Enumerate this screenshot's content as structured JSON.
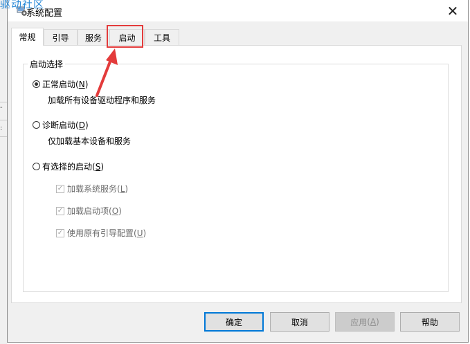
{
  "watermark": "驱动社区",
  "window": {
    "title": "系统配置",
    "close_glyph": "✕"
  },
  "tabs": [
    {
      "label": "常规",
      "active": true
    },
    {
      "label": "引导",
      "active": false
    },
    {
      "label": "服务",
      "active": false
    },
    {
      "label": "启动",
      "active": false
    },
    {
      "label": "工具",
      "active": false
    }
  ],
  "startup_group": {
    "title": "启动选择",
    "options": [
      {
        "label": "正常启动",
        "key": "N",
        "desc": "加载所有设备驱动程序和服务",
        "checked": true
      },
      {
        "label": "诊断启动",
        "key": "D",
        "desc": "仅加载基本设备和服务",
        "checked": false
      },
      {
        "label": "有选择的启动",
        "key": "S",
        "checked": false
      }
    ],
    "sub_options": [
      {
        "label": "加载系统服务",
        "key": "L",
        "checked": true,
        "disabled": true
      },
      {
        "label": "加载启动项",
        "key": "O",
        "checked": true,
        "disabled": true
      },
      {
        "label": "使用原有引导配置",
        "key": "U",
        "checked": true,
        "disabled": true
      }
    ]
  },
  "buttons": {
    "ok": "确定",
    "cancel": "取消",
    "apply": {
      "label": "应用",
      "key": "A"
    },
    "help": "帮助"
  },
  "colors": {
    "highlight": "#e33b3b",
    "focus": "#0078d7"
  }
}
